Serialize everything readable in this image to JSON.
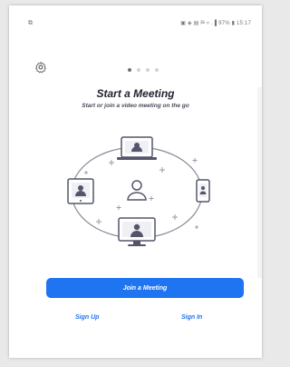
{
  "status_bar": {
    "left": "⧉",
    "right": "▣ ◈ ▤ ⛿ ▿ .▐ 97% ▮ 15:17"
  },
  "onboarding": {
    "page_indicator": {
      "count": 4,
      "active_index": 0
    },
    "title": "Start a Meeting",
    "subtitle": "Start or join a video meeting on the go"
  },
  "actions": {
    "join_label": "Join a Meeting",
    "sign_up_label": "Sign Up",
    "sign_in_label": "Sign In"
  },
  "colors": {
    "accent": "#1f74f2",
    "title_text": "#232333",
    "background": "#ffffff"
  },
  "icons": [
    "settings-gear-icon",
    "laptop-icon",
    "tablet-icon",
    "phone-icon",
    "monitor-icon",
    "user-icon",
    "sparkle-icon"
  ]
}
